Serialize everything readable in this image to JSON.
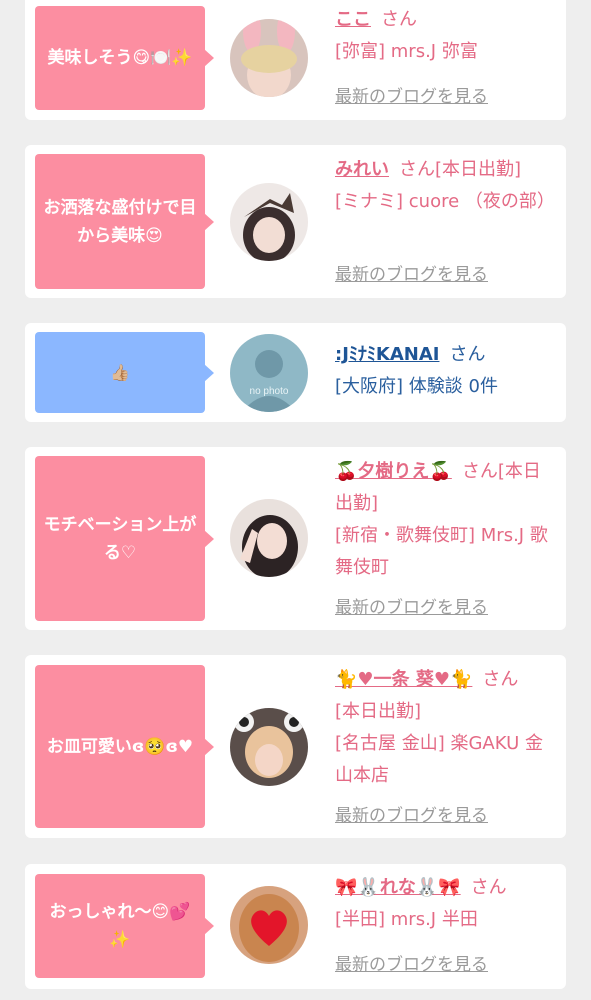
{
  "posts": [
    {
      "bubble": "美味しそう😋🍽️✨",
      "name": "ここ",
      "san": "さん",
      "line2": "[弥富] mrs.J 弥富",
      "line3": "",
      "link": "最新のブログを見る"
    },
    {
      "bubble": "お洒落な盛付けで目から美味😍",
      "name": "みれい",
      "san": "さん[本日出勤]",
      "line2": "[ミナミ] cuore （夜の部）",
      "line3": "",
      "link": "最新のブログを見る"
    },
    {
      "bubble": "👍🏼",
      "name": ":JﾐﾅﾐKANAI",
      "san": "さん",
      "line2": "[大阪府] 体験談 0件",
      "line3": "",
      "link": "",
      "avatar_text": "no photo"
    },
    {
      "bubble": "モチベーション上がる♡",
      "name": "🍒夕樹りえ🍒",
      "san": "さん[本日出勤]",
      "line2": "[新宿・歌舞伎町] Mrs.J 歌舞伎町",
      "line3": "",
      "link": "最新のブログを見る"
    },
    {
      "bubble": "お皿可愛いɞ🥺ɞ♥",
      "name": "🐈♥一条 葵♥🐈",
      "san": "さん",
      "line2": "[本日出勤]",
      "line3": "[名古屋 金山] 楽GAKU 金山本店",
      "link": "最新のブログを見る"
    },
    {
      "bubble": "おっしゃれ〜😊💕✨",
      "name": "🎀🐰れな🐰🎀",
      "san": "さん",
      "line2": "[半田] mrs.J 半田",
      "line3": "",
      "link": "最新のブログを見る"
    }
  ]
}
